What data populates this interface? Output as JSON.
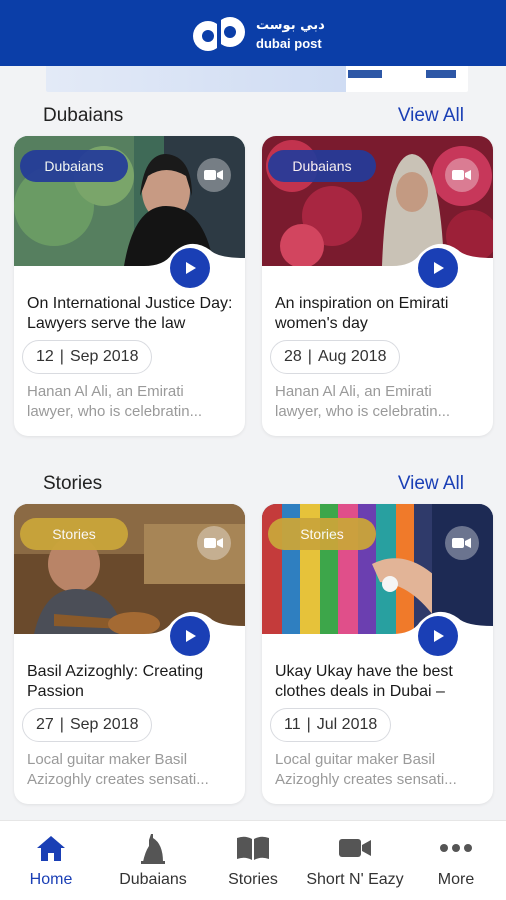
{
  "header": {
    "logo_arabic": "دبي بوست",
    "logo_english": "dubai post"
  },
  "sections": [
    {
      "title": "Dubaians",
      "view_all": "View All",
      "cards": [
        {
          "tag": "Dubaians",
          "title": "On International Justice Day: Lawyers serve the law",
          "day": "12",
          "month_year": "Sep 2018",
          "desc_line1": "Hanan Al Ali, an Emirati",
          "desc_line2": "lawyer, who is celebratin..."
        },
        {
          "tag": "Dubaians",
          "title": "An inspiration on Emirati women's day",
          "day": "28",
          "month_year": "Aug 2018",
          "desc_line1": "Hanan Al Ali, an Emirati",
          "desc_line2": "lawyer, who is celebratin..."
        }
      ]
    },
    {
      "title": "Stories",
      "view_all": "View All",
      "cards": [
        {
          "tag": "Stories",
          "title": "Basil Azizoghly: Creating Passion",
          "day": "27",
          "month_year": "Sep 2018",
          "desc_line1": "Local guitar maker Basil",
          "desc_line2": "Azizoghly creates sensati..."
        },
        {
          "tag": "Stories",
          "title": "Ukay Ukay have the best clothes deals in Dubai –",
          "day": "11",
          "month_year": "Jul 2018",
          "desc_line1": "Local guitar maker Basil",
          "desc_line2": "Azizoghly creates sensati..."
        }
      ]
    }
  ],
  "nav": [
    {
      "label": "Home",
      "icon": "home-icon",
      "active": true
    },
    {
      "label": "Dubaians",
      "icon": "tower-icon",
      "active": false
    },
    {
      "label": "Stories",
      "icon": "book-icon",
      "active": false
    },
    {
      "label": "Short N' Eazy",
      "icon": "video-camera-icon",
      "active": false
    },
    {
      "label": "More",
      "icon": "more-dots-icon",
      "active": false
    }
  ],
  "colors": {
    "primary": "#0b3ea8",
    "accent": "#1a3fb5",
    "tag_blue": "#243b9a",
    "tag_gold": "#caa53a"
  }
}
